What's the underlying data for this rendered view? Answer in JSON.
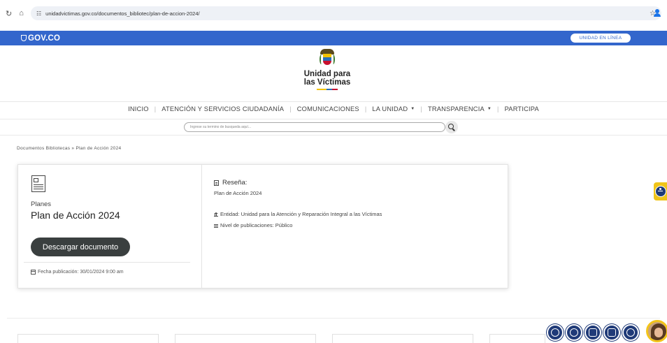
{
  "browser": {
    "url": "unidadvictimas.gov.co/documentos_bibliotec/plan-de-accion-2024/"
  },
  "gov_bar": {
    "logo": "GOV.CO",
    "button": "UNIDAD EN LÍNEA",
    "color": "#3366cc"
  },
  "brand": {
    "line1": "Unidad para",
    "line2": "las Víctimas",
    "flag_colors": [
      "#f2c200",
      "#2a6fb8",
      "#c8102e"
    ]
  },
  "nav": {
    "items": [
      {
        "label": "INICIO",
        "dropdown": false
      },
      {
        "label": "ATENCIÓN Y SERVICIOS CIUDADANÍA",
        "dropdown": false
      },
      {
        "label": "COMUNICACIONES",
        "dropdown": false
      },
      {
        "label": "LA UNIDAD",
        "dropdown": true
      },
      {
        "label": "TRANSPARENCIA",
        "dropdown": true
      },
      {
        "label": "PARTICIPA",
        "dropdown": false
      }
    ]
  },
  "search": {
    "placeholder": "Ingrese su termino de busqueda aquí..."
  },
  "breadcrumb": "Documentos Bibliotecas » Plan de Acción 2024",
  "document": {
    "category": "Planes",
    "title": "Plan de Acción 2024",
    "download_label": "Descargar documento",
    "date": "Fecha publicación: 30/01/2024 9:00 am",
    "resena_label": "Reseña:",
    "resena_text": "Plan de Acción 2024",
    "entidad": "Entidad: Unidad para la Atención y Reparación Integral a las Víctimas",
    "nivel": "Nivel de publicaciones: Público"
  },
  "accent_colors": {
    "dark_button": "#3a3f3f",
    "fab": "#1f3a78",
    "a11y": "#f0c419"
  }
}
